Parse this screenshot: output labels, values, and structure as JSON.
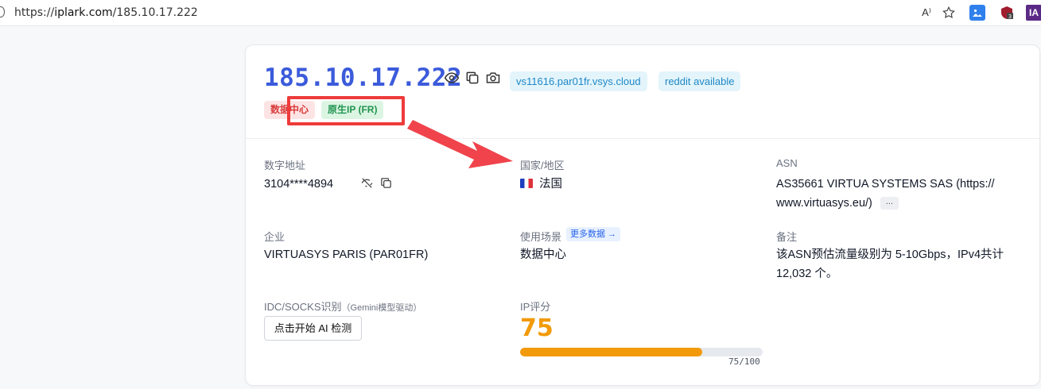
{
  "browser": {
    "url_scheme": "https://",
    "url_host": "iplark.com",
    "url_path": "/185.10.17.222",
    "read_aloud": "A⁾",
    "ext_badge": "3",
    "ext_ia": "IA"
  },
  "ip": {
    "address": "185.10.17.222",
    "chips": [
      "vs11616.par01fr.vsys.cloud",
      "reddit available"
    ],
    "badges": [
      "数据中心",
      "原生IP (FR)"
    ]
  },
  "fields": {
    "numeric_label": "数字地址",
    "numeric_value": "3104****4894",
    "country_label": "国家/地区",
    "country_value": "法国",
    "asn_label": "ASN",
    "asn_line1": "AS35661 VIRTUA SYSTEMS SAS (https://",
    "asn_line2": "www.virtuasys.eu/)",
    "asn_more": "...",
    "org_label": "企业",
    "org_value": "VIRTUASYS PARIS (PAR01FR)",
    "usage_label": "使用场景",
    "usage_more": "更多数据 →",
    "usage_value": "数据中心",
    "note_label": "备注",
    "note_line1": "该ASN预估流量级别为 5-10Gbps，IPv4共计",
    "note_line2": "12,032 个。",
    "idc_label": "IDC/SOCKS识别",
    "idc_hint": "（Gemini模型驱动）",
    "ai_button": "点击开始 AI 检测",
    "score_label": "IP评分",
    "score_value": "75",
    "score_fraction": 0.75,
    "score_text": "75/100"
  },
  "colors": {
    "ip_blue": "#3b5bdb",
    "score_orange": "#f29a0a",
    "annotation_red": "#ee3b3b"
  },
  "icons": [
    "info-icon",
    "read-aloud-icon",
    "favorite-star-icon",
    "image-extension-icon",
    "shield-extension-icon",
    "ia-extension-icon",
    "eye-icon",
    "copy-icon",
    "camera-icon",
    "eye-off-icon"
  ]
}
